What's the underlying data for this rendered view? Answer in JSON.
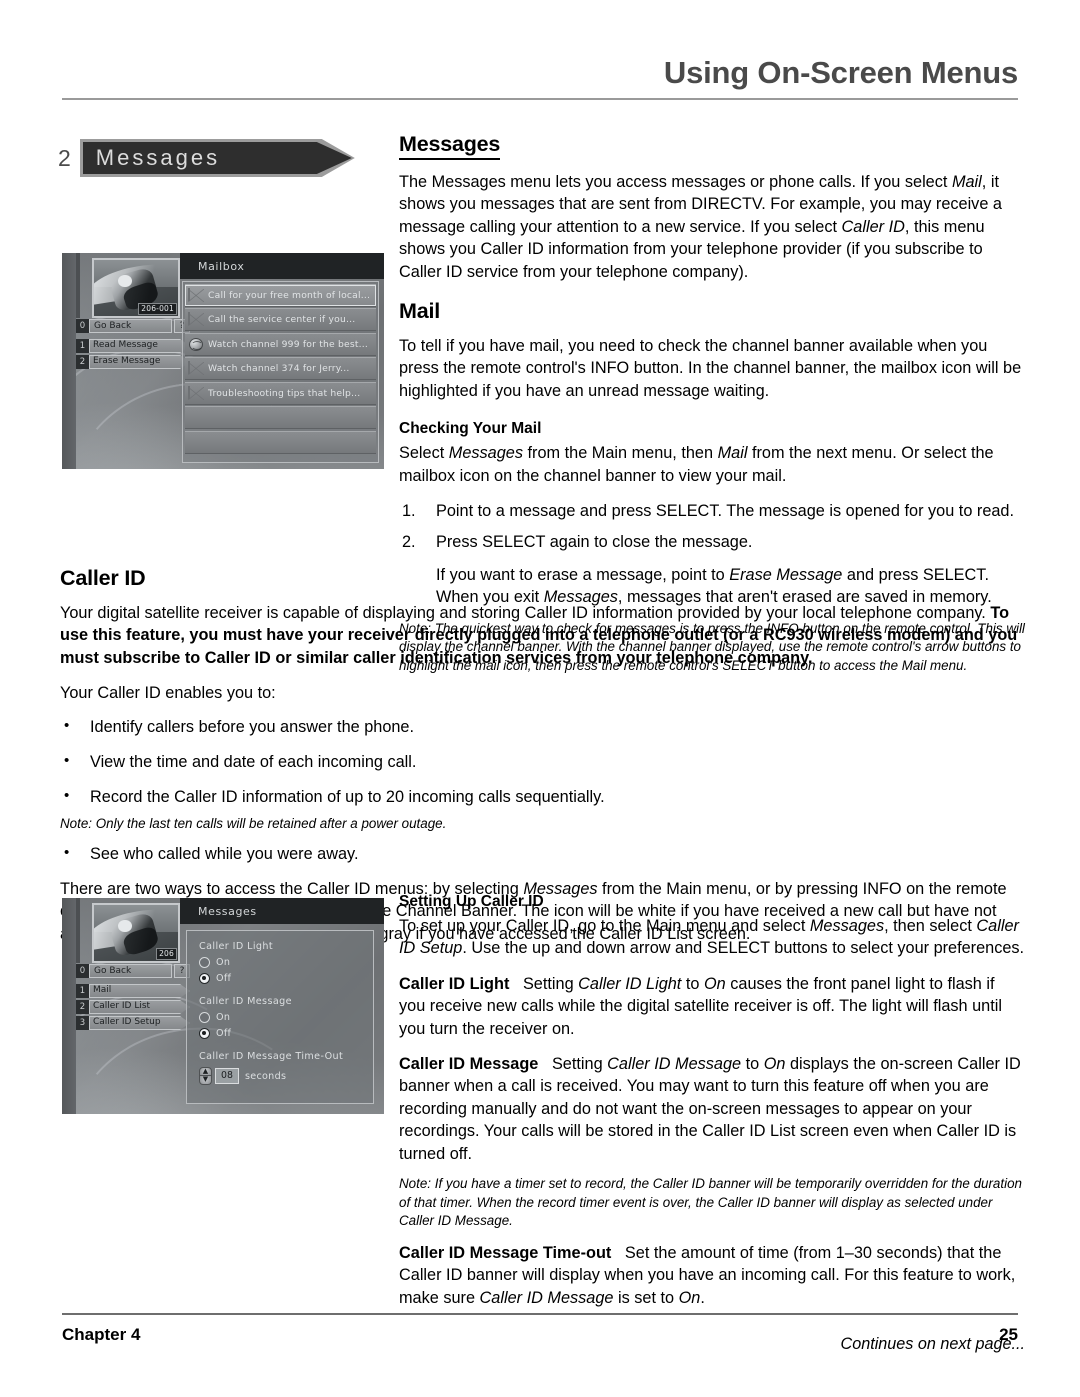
{
  "header": {
    "title": "Using On-Screen Menus"
  },
  "chapter_tab": {
    "number": "2",
    "label": "Messages"
  },
  "sections": {
    "messages": {
      "heading": "Messages",
      "paragraph": "The Messages menu lets you access messages or phone calls. If you select Mail, it shows you messages that are sent from DIRECTV. For example, you may receive a message calling your attention to a new service. If you select Caller ID, this menu shows you Caller ID information from your telephone provider (if you subscribe to Caller ID service from your telephone company)."
    },
    "mail": {
      "heading": "Mail",
      "paragraph": "To tell if you have mail, you need to check the channel banner available when you press the remote control's INFO button. In the channel banner, the mailbox icon will be highlighted if you have an unread message waiting.",
      "sub_heading": "Checking Your Mail",
      "sub_paragraph": "Select Messages from the Main menu, then Mail from the next menu. Or select the mailbox icon on the channel banner to view your mail.",
      "steps": [
        {
          "num": "1.",
          "text": "Point to a message and press SELECT. The message is opened for you to read."
        },
        {
          "num": "2.",
          "text": "Press SELECT again to close the message."
        }
      ],
      "erase_paragraph": "If you want to erase a message, point to Erase Message and press SELECT. When you exit Messages, messages that aren't erased are saved in memory.",
      "note": "Note: The quickest way to check for messages is to press the INFO button on the remote control. This will display the channel banner. With the channel banner displayed, use the remote control's arrow buttons to highlight the mail icon, then press the remote control's SELECT button to access the Mail menu."
    },
    "caller_id": {
      "heading": "Caller ID",
      "bold_paragraph_lead": "Your digital satellite receiver is capable of displaying and storing Caller ID information provided by your local telephone company. ",
      "bold_paragraph_bold": "To use this feature, you must have your receiver directly plugged into a telephone outlet (or a RC930 wireless modem) and you must subscribe to Caller ID or similar caller identification services from your telephone company.",
      "enables_label": "Your Caller ID enables you to:",
      "bullets": [
        "Identify callers before you answer the phone.",
        "View the time and date of each incoming call.",
        "Record the Caller ID information of up to 20 incoming calls sequentially."
      ],
      "bullet_note": "Note: Only the last ten calls will be retained after a power outage.",
      "last_bullet": "See who called while you were away.",
      "access_paragraph": "There are two ways to access the Caller ID menus: by selecting Messages from the Main menu, or by pressing INFO on the remote control and selecting the telephone icon in the Channel Banner. The icon will be white if you have received a new call but have not accessed the Caller ID List screen. It will be gray if you have accessed the Caller ID List screen."
    },
    "setting_up": {
      "heading": "Setting Up Caller ID",
      "intro": "To set up your Caller ID, go to the Main menu and select Messages, then select Caller ID Setup. Use the up and down arrow and SELECT buttons to select your preferences.",
      "light_term": "Caller ID Light",
      "light_text": "Setting Caller ID Light to On causes the front panel light to flash if you receive new calls while the digital satellite receiver is off. The light will flash until you turn the receiver on.",
      "message_term": "Caller ID Message",
      "message_text": "Setting Caller ID Message to On displays the  on-screen Caller ID banner when a call is received. You may want to turn this feature off when you are recording manually and do not want the on-screen messages to appear on your recordings. Your calls will be stored in the Caller ID List screen even when Caller ID is turned off.",
      "message_note": "Note: If you have a timer set to record, the Caller ID banner will be temporarily overridden for the duration of that timer. When the record timer event is over, the Caller ID banner will display as selected under Caller ID Message.",
      "timeout_term": "Caller ID Message Time-out",
      "timeout_text": "Set the amount of time (from 1–30 seconds) that the Caller ID banner will display when you have an incoming call. For this feature to work, make sure Caller ID Message is set to On.",
      "continues": "Continues on next page..."
    }
  },
  "screenshot_mailbox": {
    "panel_title": "Mailbox",
    "channel_number": "206-001",
    "menu": [
      {
        "num": "0",
        "label": "Go Back",
        "help": "?"
      },
      {
        "num": "1",
        "label": "Read Message"
      },
      {
        "num": "2",
        "label": "Erase Message"
      }
    ],
    "messages": [
      {
        "icon": "envelope-open-icon",
        "text": "Call for your free month of local...",
        "selected": true
      },
      {
        "icon": "envelope-icon",
        "text": "Call the service center if you...",
        "selected": false
      },
      {
        "icon": "globe-icon",
        "text": "Watch channel 999 for the best...",
        "selected": false
      },
      {
        "icon": "envelope-icon",
        "text": "Watch channel 374 for Jerry...",
        "selected": false
      },
      {
        "icon": "envelope-open-icon",
        "text": "Troubleshooting tips that help...",
        "selected": false
      }
    ]
  },
  "screenshot_callerid": {
    "panel_title": "Messages",
    "channel_number": "206",
    "menu": [
      {
        "num": "0",
        "label": "Go Back",
        "help": "?"
      },
      {
        "num": "1",
        "label": "Mail"
      },
      {
        "num": "2",
        "label": "Caller ID List"
      },
      {
        "num": "3",
        "label": "Caller ID Setup"
      }
    ],
    "settings": {
      "light_label": "Caller ID Light",
      "light_on": "On",
      "light_off": "Off",
      "light_value": "Off",
      "message_label": "Caller ID Message",
      "message_on": "On",
      "message_off": "Off",
      "message_value": "Off",
      "timeout_label": "Caller ID Message Time-Out",
      "timeout_value": "08",
      "timeout_unit": "seconds"
    }
  },
  "footer": {
    "chapter": "Chapter 4",
    "page": "25"
  }
}
